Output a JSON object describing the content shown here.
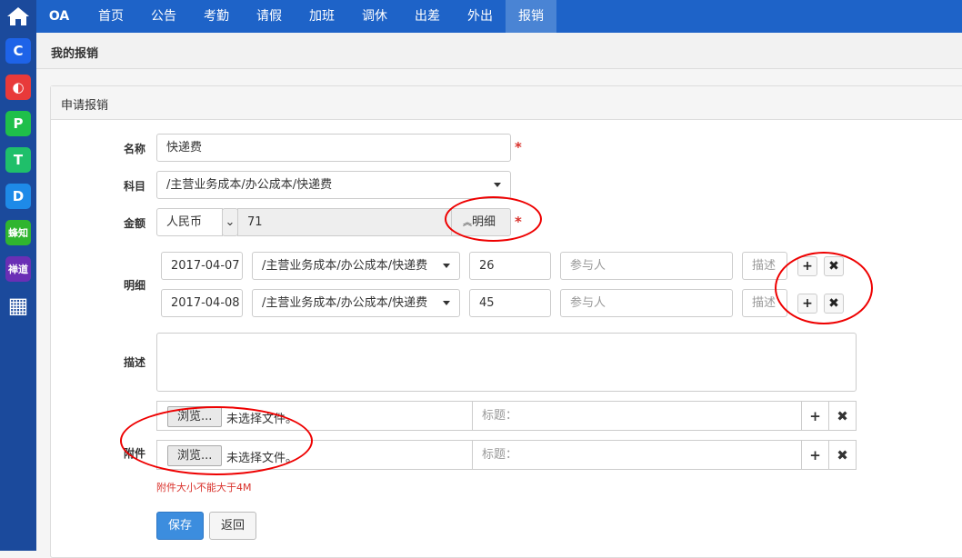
{
  "topbar": {
    "logo": "OA",
    "items": [
      "首页",
      "公告",
      "考勤",
      "请假",
      "加班",
      "调休",
      "出差",
      "外出",
      "报销"
    ],
    "active": "报销"
  },
  "sidebar": {
    "apps": [
      {
        "icon": "C",
        "name": "c-app-icon",
        "color": "#1e63e8"
      },
      {
        "icon": "◐",
        "name": "half-circle-app-icon",
        "color": "#e83a3a"
      },
      {
        "icon": "P",
        "name": "p-app-icon",
        "color": "#1fbf4a"
      },
      {
        "icon": "T",
        "name": "t-app-icon",
        "color": "#1fbf6a"
      },
      {
        "icon": "D",
        "name": "d-app-icon",
        "color": "#1e8ae8"
      },
      {
        "icon": "蜂知",
        "name": "fengzhi-app-icon",
        "color": "#2fb52f"
      },
      {
        "icon": "禅道",
        "name": "chandao-app-icon",
        "color": "#6a2fb5"
      },
      {
        "icon": "▦",
        "name": "grid-apps-icon",
        "color": "#1b4a9c"
      }
    ]
  },
  "breadcrumb": "我的报销",
  "panel_title": "申请报销",
  "form": {
    "name_label": "名称",
    "name_value": "快递费",
    "subject_label": "科目",
    "subject_value": "/主营业务成本/办公成本/快递费",
    "amount_label": "金额",
    "currency": "人民币",
    "amount_value": "71",
    "detail_toggle": "明细",
    "detail_label": "明细",
    "details": [
      {
        "date": "2017-04-07",
        "subject": "/主营业务成本/办公成本/快递费",
        "amount": "26",
        "participant_ph": "参与人",
        "desc_ph": "描述"
      },
      {
        "date": "2017-04-08",
        "subject": "/主营业务成本/办公成本/快递费",
        "amount": "45",
        "participant_ph": "参与人",
        "desc_ph": "描述"
      }
    ],
    "desc_label": "描述",
    "attach_label": "附件",
    "attachments": [
      {
        "browse": "浏览...",
        "file": "未选择文件。",
        "title_ph": "标题："
      },
      {
        "browse": "浏览...",
        "file": "未选择文件。",
        "title_ph": "标题："
      }
    ],
    "attach_note": "附件大小不能大于4M",
    "save": "保存",
    "back": "返回",
    "required_mark": "*"
  }
}
